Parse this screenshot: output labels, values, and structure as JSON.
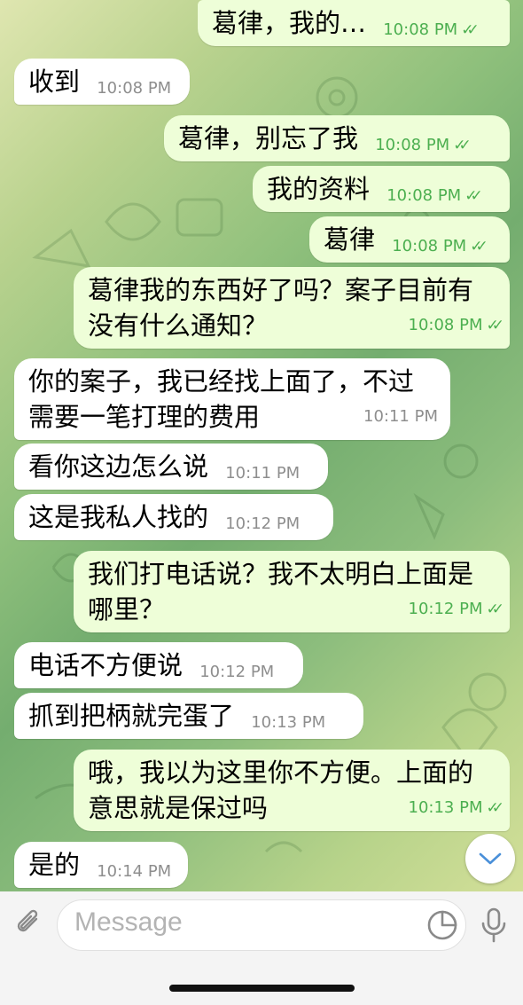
{
  "messages": [
    {
      "dir": "out",
      "text": "葛律，我的…",
      "time": "10:08 PM",
      "read": true
    },
    {
      "dir": "in",
      "text": "收到",
      "time": "10:08 PM"
    },
    {
      "dir": "out",
      "text": "葛律，别忘了我",
      "time": "10:08 PM",
      "read": true
    },
    {
      "dir": "out",
      "text": "我的资料",
      "time": "10:08 PM",
      "read": true
    },
    {
      "dir": "out",
      "text": "葛律",
      "time": "10:08 PM",
      "read": true
    },
    {
      "dir": "out",
      "text": "葛律我的东西好了吗？案子目前有没有什么通知？",
      "time": "10:08 PM",
      "read": true
    },
    {
      "dir": "in",
      "text": "你的案子，我已经找上面了，不过需要一笔打理的费用",
      "time": "10:11 PM"
    },
    {
      "dir": "in",
      "text": "看你这边怎么说",
      "time": "10:11 PM"
    },
    {
      "dir": "in",
      "text": "这是我私人找的",
      "time": "10:12 PM"
    },
    {
      "dir": "out",
      "text": "我们打电话说？我不太明白上面是哪里？",
      "time": "10:12 PM",
      "read": true
    },
    {
      "dir": "in",
      "text": "电话不方便说",
      "time": "10:12 PM"
    },
    {
      "dir": "in",
      "text": "抓到把柄就完蛋了",
      "time": "10:13 PM"
    },
    {
      "dir": "out",
      "text": "哦，我以为这里你不方便。上面的意思就是保过吗",
      "time": "10:13 PM",
      "read": true
    },
    {
      "dir": "in",
      "text": "是的",
      "time": "10:14 PM"
    }
  ],
  "composer": {
    "placeholder": "Message",
    "attach_icon": "paperclip-icon",
    "sticker_icon": "sticker-icon",
    "mic_icon": "microphone-icon"
  },
  "scroll_button_icon": "chevron-down-icon",
  "colors": {
    "outgoing_bubble": "#eefed8",
    "incoming_bubble": "#ffffff",
    "outgoing_meta": "#4caf50",
    "accent": "#4a90d9"
  }
}
